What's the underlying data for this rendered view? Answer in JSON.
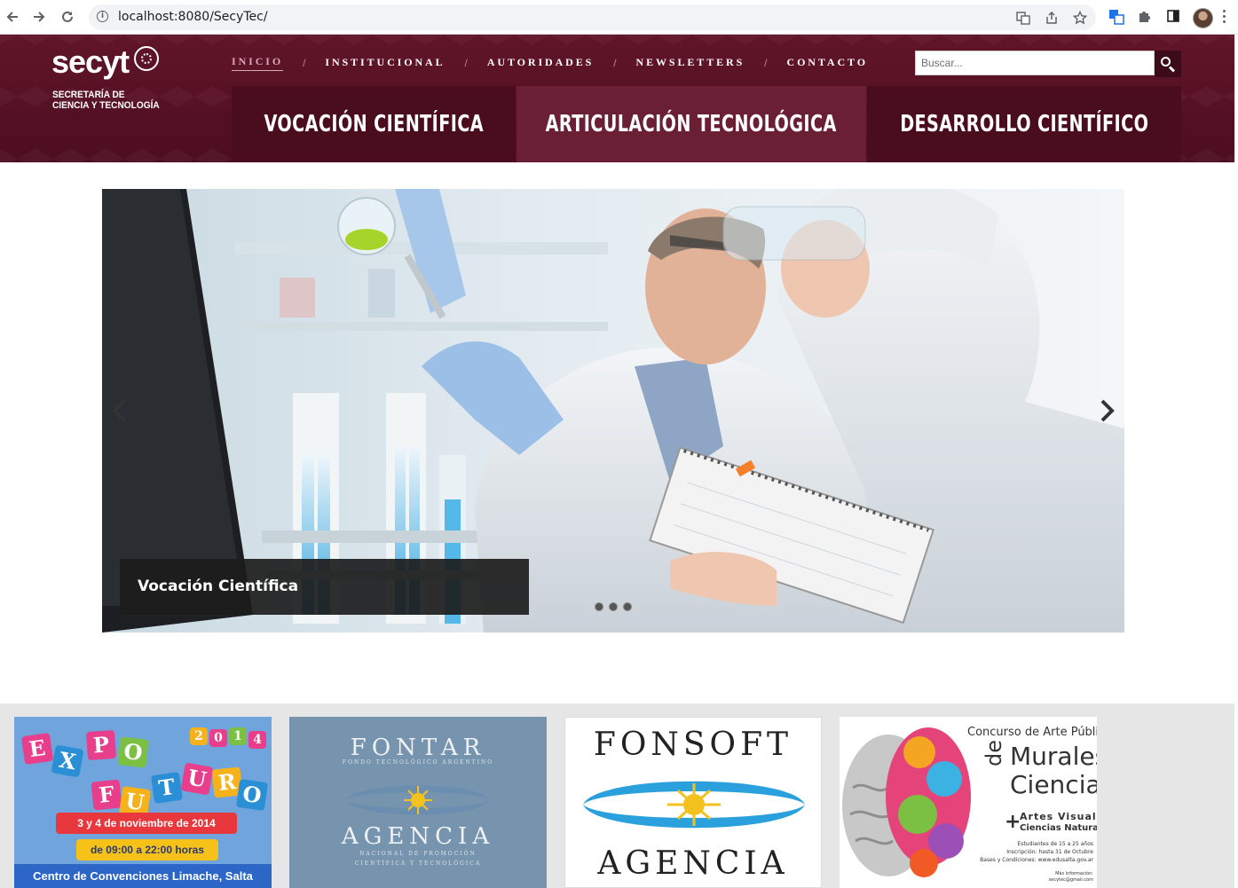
{
  "browser": {
    "url": "localhost:8080/SecyTec/"
  },
  "header": {
    "logo_word": "secyt",
    "logo_sub_line1": "SECRETARÍA DE",
    "logo_sub_line2": "CIENCIA Y TECNOLOGÍA",
    "menu": [
      {
        "label": "INICIO",
        "active": true
      },
      {
        "label": "INSTITUCIONAL",
        "active": false
      },
      {
        "label": "AUTORIDADES",
        "active": false
      },
      {
        "label": "NEWSLETTERS",
        "active": false
      },
      {
        "label": "CONTACTO",
        "active": false
      }
    ],
    "separator": "/",
    "search_placeholder": "Buscar...",
    "tabs": [
      {
        "label": "VOCACIÓN CIENTÍFICA"
      },
      {
        "label": "ARTICULACIÓN TECNOLÓGICA"
      },
      {
        "label": "DESARROLLO CIENTÍFICO"
      }
    ]
  },
  "slider": {
    "caption": "Vocación Científica",
    "slide_count": 3,
    "active_slide": 1
  },
  "banners": {
    "expo": {
      "letters": [
        "E",
        "X",
        "P",
        "O",
        "F",
        "U",
        "T",
        "U",
        "R",
        "O"
      ],
      "year_digits": [
        "2",
        "0",
        "1",
        "4"
      ],
      "date": "3 y 4 de noviembre de 2014",
      "hours": "de 09:00 a 22:00 horas",
      "venue": "Centro de Convenciones Limache, Salta"
    },
    "fontar": {
      "title": "FONTAR",
      "subtitle": "FONDO TECNOLÓGICO ARGENTINO",
      "agency": "AGENCIA",
      "agency_sub1": "NACIONAL DE PROMOCIÓN",
      "agency_sub2": "CIENTÍFICA Y TECNOLÓGICA"
    },
    "fonsoft": {
      "title": "FONSOFT",
      "agency": "AGENCIA"
    },
    "murales": {
      "heading": "Concurso de Arte Público",
      "de": "de",
      "murales": "Murales",
      "ciencias": "Ciencias",
      "plus": "+",
      "artes": "Artes Visuales",
      "naturales": "Ciencias Naturales",
      "line1": "Estudiantes de 15 a 25 años",
      "line2": "Inscripción: hasta 31 de Octubre",
      "line3": "Bases y Condiciones: www.edusalta.gov.ar",
      "info1": "Más información:",
      "info2": "secytec@gmail.com"
    }
  }
}
